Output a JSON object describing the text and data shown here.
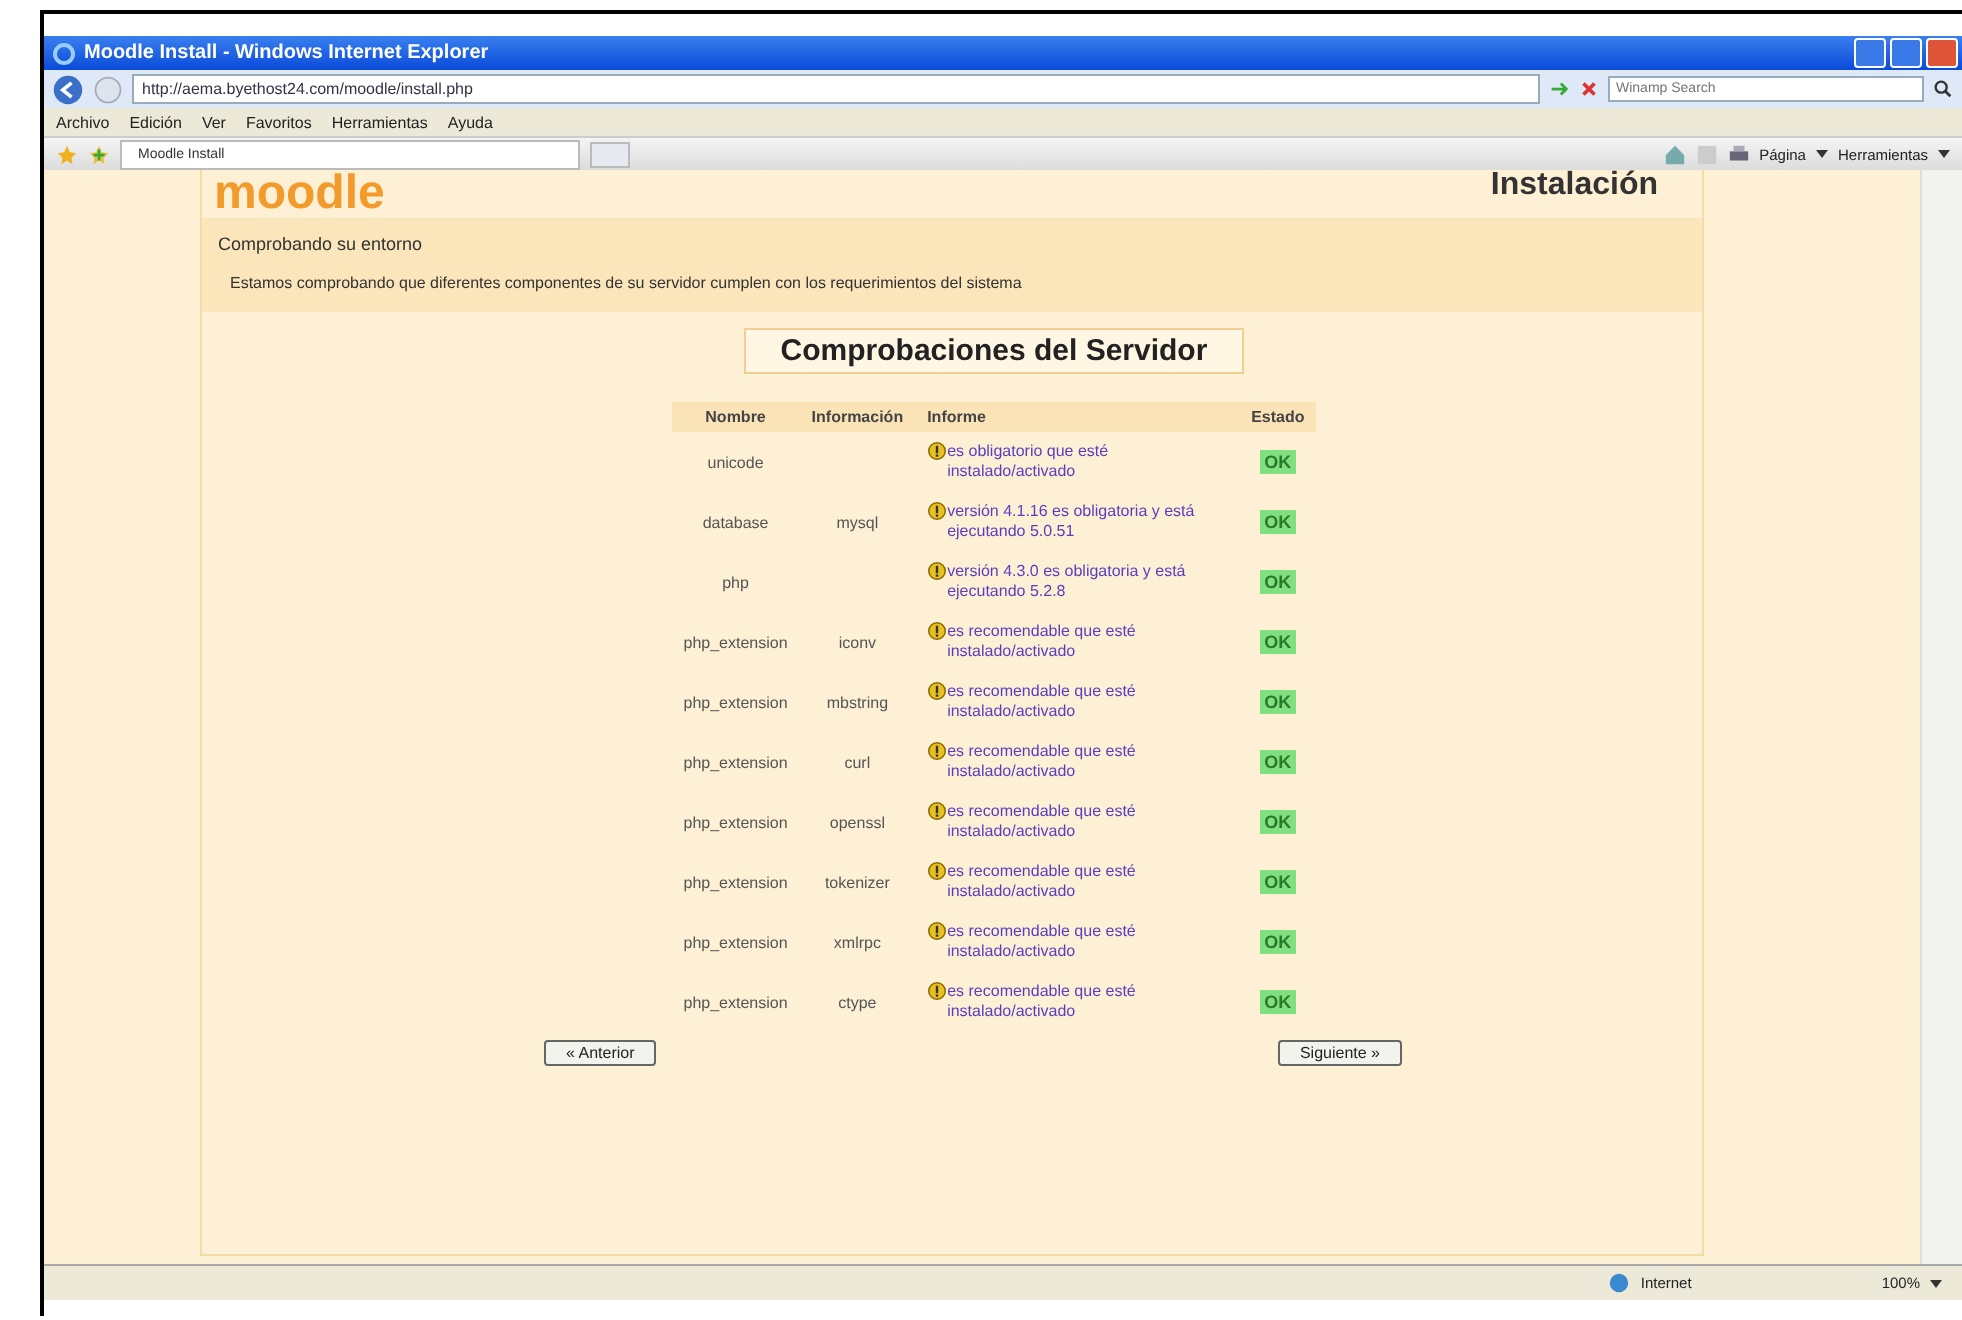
{
  "window": {
    "title": "Moodle Install - Windows Internet Explorer"
  },
  "address_bar": {
    "url": "http://aema.byethost24.com/moodle/install.php"
  },
  "search": {
    "placeholder": "Winamp Search"
  },
  "menu": [
    "Archivo",
    "Edición",
    "Ver",
    "Favoritos",
    "Herramientas",
    "Ayuda"
  ],
  "tabs": [
    {
      "label": "Moodle Install",
      "selected": true
    }
  ],
  "command_bar": {
    "page": "Página",
    "tools": "Herramientas"
  },
  "page": {
    "logo": "moodle",
    "heading": "Instalación",
    "section": "Comprobando su entorno",
    "intro": "Estamos comprobando que diferentes componentes de su servidor cumplen con los requerimientos del sistema",
    "title": "Comprobaciones del Servidor",
    "columns": [
      "Nombre",
      "Información",
      "Informe",
      "Estado"
    ],
    "rows": [
      {
        "name": "unicode",
        "info": "",
        "report": "es obligatorio que esté instalado/activado",
        "status": "OK"
      },
      {
        "name": "database",
        "info": "mysql",
        "report": "versión 4.1.16 es obligatoria y está ejecutando 5.0.51",
        "status": "OK"
      },
      {
        "name": "php",
        "info": "",
        "report": "versión 4.3.0 es obligatoria y está ejecutando 5.2.8",
        "status": "OK"
      },
      {
        "name": "php_extension",
        "info": "iconv",
        "report": "es recomendable que esté instalado/activado",
        "status": "OK"
      },
      {
        "name": "php_extension",
        "info": "mbstring",
        "report": "es recomendable que esté instalado/activado",
        "status": "OK"
      },
      {
        "name": "php_extension",
        "info": "curl",
        "report": "es recomendable que esté instalado/activado",
        "status": "OK"
      },
      {
        "name": "php_extension",
        "info": "openssl",
        "report": "es recomendable que esté instalado/activado",
        "status": "OK"
      },
      {
        "name": "php_extension",
        "info": "tokenizer",
        "report": "es recomendable que esté instalado/activado",
        "status": "OK"
      },
      {
        "name": "php_extension",
        "info": "xmlrpc",
        "report": "es recomendable que esté instalado/activado",
        "status": "OK"
      },
      {
        "name": "php_extension",
        "info": "ctype",
        "report": "es recomendable que esté instalado/activado",
        "status": "OK"
      }
    ],
    "prev": "« Anterior",
    "next": "Siguiente »"
  },
  "status_bar": {
    "zone": "Internet",
    "zoom": "100%"
  }
}
